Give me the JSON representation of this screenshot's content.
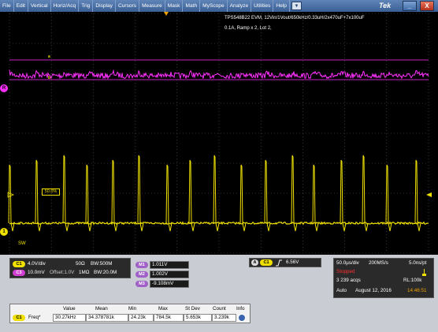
{
  "menu": [
    "File",
    "Edit",
    "Vertical",
    "Horiz/Acq",
    "Trig",
    "Display",
    "Cursors",
    "Measure",
    "Mask",
    "Math",
    "MyScope",
    "Analyze",
    "Utilities",
    "Help"
  ],
  "brand": "Tek",
  "window": {
    "minimize": "_",
    "close": "X"
  },
  "scope": {
    "config_line1": "TPS548B22 EVM, 12Vin/1Vout/650kHz/0.33uH/2x470uF+7x100uF",
    "config_line2": "0.1A, Ramp x 2, Lot 2,",
    "cursor_a_label": "a",
    "cursor_b_label": "b",
    "trigger_level_label": "50.0%",
    "ch1_marker": "1",
    "sw_label": "SW",
    "ref_marker": "R"
  },
  "colors": {
    "ch1": "#f0e000",
    "math": "#ff30ff",
    "background": "#000000"
  },
  "channels": {
    "ch1_badge": "C1",
    "ch1_scale": "4.0V/div",
    "ch1_impedance": "50Ω",
    "ch1_bw": "BW:500M",
    "ch3_badge": "C3",
    "ch3_scale": "10.0mV",
    "ch3_offset": "Offset:1.0V",
    "ch3_impedance": "1MΩ",
    "ch3_bw": "BW:20.0M"
  },
  "math_vals": [
    {
      "badge": "M1",
      "value": "1.011V"
    },
    {
      "badge": "M2",
      "value": "1.002V"
    },
    {
      "badge": "M3",
      "value": "-9.108mV"
    }
  ],
  "trigger": {
    "mode_badge": "A",
    "source_badge": "C1",
    "slope_icon": "rising-edge",
    "level": "6.56V"
  },
  "horizontal": {
    "scale": "50.0µs/div",
    "sample_rate": "200MS/s",
    "resolution": "5.0ns/pt",
    "status": "Stopped",
    "acqs": "3 239 acqs",
    "record_length": "RL:100k",
    "mode": "Auto",
    "date": "August 12, 2016",
    "time": "14:46:51"
  },
  "measurements": {
    "headers": [
      "Value",
      "Mean",
      "Min",
      "Max",
      "St Dev",
      "Count",
      "Info"
    ],
    "row": {
      "badge": "C1",
      "name": "Freq*",
      "values": [
        "30.27kHz",
        "34.378781k",
        "24.23k",
        "784.5k",
        "5.653k",
        "3.239k"
      ]
    }
  },
  "yellow_pulses_us": [
    12,
    46,
    81,
    110,
    143,
    176,
    212,
    241,
    272,
    306,
    337,
    371,
    398,
    433,
    461,
    491,
    528
  ]
}
